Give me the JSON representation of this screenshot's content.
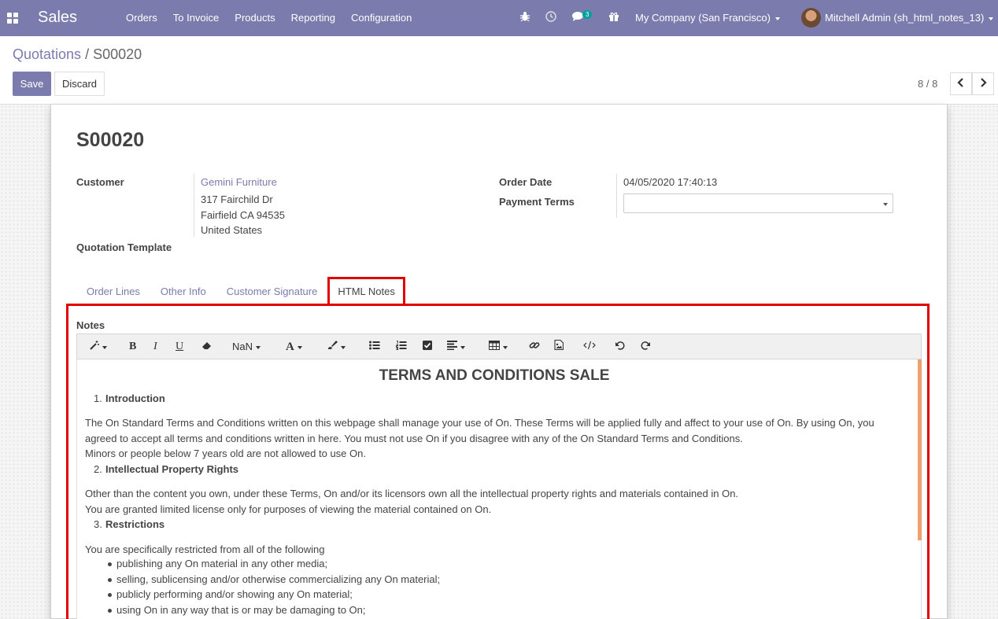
{
  "navbar": {
    "brand": "Sales",
    "menu": [
      "Orders",
      "To Invoice",
      "Products",
      "Reporting",
      "Configuration"
    ],
    "chat_badge": "3",
    "company": "My Company (San Francisco)",
    "user": "Mitchell Admin (sh_html_notes_13)"
  },
  "breadcrumb": {
    "parent": "Quotations",
    "separator": "/",
    "current": "S00020"
  },
  "buttons": {
    "save": "Save",
    "discard": "Discard"
  },
  "pager": {
    "value": "8 / 8"
  },
  "record": {
    "name": "S00020",
    "customer_label": "Customer",
    "customer_name": "Gemini Furniture",
    "address": [
      "317 Fairchild Dr",
      "Fairfield CA 94535",
      "United States"
    ],
    "template_label": "Quotation Template",
    "order_date_label": "Order Date",
    "order_date": "04/05/2020 17:40:13",
    "payment_terms_label": "Payment Terms",
    "payment_terms": ""
  },
  "tabs": [
    "Order Lines",
    "Other Info",
    "Customer Signature",
    "HTML Notes"
  ],
  "notes": {
    "label": "Notes",
    "toolbar": {
      "font_size": "NaN"
    },
    "title": "TERMS AND CONDITIONS SALE",
    "sections": [
      {
        "num": "1.",
        "heading": "Introduction"
      },
      {
        "num": "2.",
        "heading": "Intellectual Property Rights"
      },
      {
        "num": "3.",
        "heading": "Restrictions"
      }
    ],
    "intro_lines": [
      "The On Standard Terms and Conditions written on this webpage shall manage your use of On. These Terms will be applied fully and affect to your use of On. By using On, you",
      "agreed to accept all terms and conditions written in here. You must not use On if you disagree with any of the On Standard Terms and Conditions.",
      "Minors or people below 7 years old are not allowed to use On."
    ],
    "ip_lines": [
      "Other than the content you own, under these Terms, On and/or its licensors own all the intellectual property rights and materials contained in On.",
      "You are granted limited license only for purposes of viewing the material contained on On."
    ],
    "restrictions_intro": "You are specifically restricted from all of the following",
    "restrictions": [
      "publishing any On material in any other media;",
      "selling, sublicensing and/or otherwise commercializing any On material;",
      "publicly performing and/or showing any On material;",
      "using On in any way that is or may be damaging to On;"
    ]
  }
}
